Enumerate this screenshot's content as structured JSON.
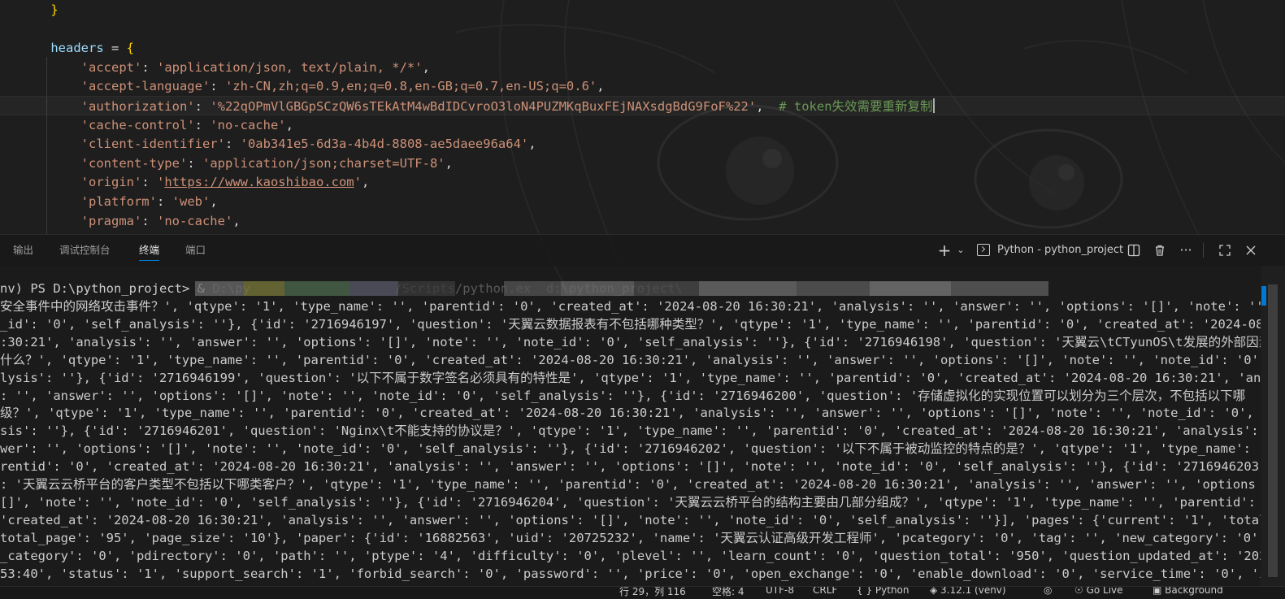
{
  "editor": {
    "lines": [
      {
        "parts": [
          {
            "t": "    ",
            "c": ""
          },
          {
            "t": "}",
            "c": "tk-brace"
          }
        ]
      },
      {
        "parts": []
      },
      {
        "parts": [
          {
            "t": "    ",
            "c": ""
          },
          {
            "t": "headers",
            "c": "tk-var"
          },
          {
            "t": " = ",
            "c": "tk-op"
          },
          {
            "t": "{",
            "c": "tk-brace"
          }
        ]
      },
      {
        "parts": [
          {
            "t": "        ",
            "c": ""
          },
          {
            "t": "'accept'",
            "c": "tk-str"
          },
          {
            "t": ": ",
            "c": "tk-op"
          },
          {
            "t": "'application/json, text/plain, */*'",
            "c": "tk-str"
          },
          {
            "t": ",",
            "c": "tk-op"
          }
        ]
      },
      {
        "parts": [
          {
            "t": "        ",
            "c": ""
          },
          {
            "t": "'accept-language'",
            "c": "tk-str"
          },
          {
            "t": ": ",
            "c": "tk-op"
          },
          {
            "t": "'zh-CN,zh;q=0.9,en;q=0.8,en-GB;q=0.7,en-US;q=0.6'",
            "c": "tk-str"
          },
          {
            "t": ",",
            "c": "tk-op"
          }
        ]
      },
      {
        "parts": [
          {
            "t": "        ",
            "c": ""
          },
          {
            "t": "'authorization'",
            "c": "tk-str"
          },
          {
            "t": ": ",
            "c": "tk-op"
          },
          {
            "t": "'%22qOPmVlGBGpSCzQW6sTEkAtM4wBdIDCvroO3loN4PUZMKqBuxFEjNAXsdgBdG9FoF%22'",
            "c": "tk-str"
          },
          {
            "t": ",  ",
            "c": "tk-op"
          },
          {
            "t": "# token失效需要重新复制",
            "c": "tk-comment"
          }
        ],
        "current": true
      },
      {
        "parts": [
          {
            "t": "        ",
            "c": ""
          },
          {
            "t": "'cache-control'",
            "c": "tk-str"
          },
          {
            "t": ": ",
            "c": "tk-op"
          },
          {
            "t": "'no-cache'",
            "c": "tk-str"
          },
          {
            "t": ",",
            "c": "tk-op"
          }
        ]
      },
      {
        "parts": [
          {
            "t": "        ",
            "c": ""
          },
          {
            "t": "'client-identifier'",
            "c": "tk-str"
          },
          {
            "t": ": ",
            "c": "tk-op"
          },
          {
            "t": "'0ab341e5-6d3a-4b4d-8808-ae5daee96a64'",
            "c": "tk-str"
          },
          {
            "t": ",",
            "c": "tk-op"
          }
        ]
      },
      {
        "parts": [
          {
            "t": "        ",
            "c": ""
          },
          {
            "t": "'content-type'",
            "c": "tk-str"
          },
          {
            "t": ": ",
            "c": "tk-op"
          },
          {
            "t": "'application/json;charset=UTF-8'",
            "c": "tk-str"
          },
          {
            "t": ",",
            "c": "tk-op"
          }
        ]
      },
      {
        "parts": [
          {
            "t": "        ",
            "c": ""
          },
          {
            "t": "'origin'",
            "c": "tk-str"
          },
          {
            "t": ": ",
            "c": "tk-op"
          },
          {
            "t": "'",
            "c": "tk-str"
          },
          {
            "t": "https://www.kaoshibao.com",
            "c": "tk-url"
          },
          {
            "t": "'",
            "c": "tk-str"
          },
          {
            "t": ",",
            "c": "tk-op"
          }
        ]
      },
      {
        "parts": [
          {
            "t": "        ",
            "c": ""
          },
          {
            "t": "'platform'",
            "c": "tk-str"
          },
          {
            "t": ": ",
            "c": "tk-op"
          },
          {
            "t": "'web'",
            "c": "tk-str"
          },
          {
            "t": ",",
            "c": "tk-op"
          }
        ]
      },
      {
        "parts": [
          {
            "t": "        ",
            "c": ""
          },
          {
            "t": "'pragma'",
            "c": "tk-str"
          },
          {
            "t": ": ",
            "c": "tk-op"
          },
          {
            "t": "'no-cache'",
            "c": "tk-str"
          },
          {
            "t": ",",
            "c": "tk-op"
          }
        ]
      }
    ]
  },
  "panel": {
    "tabs": [
      {
        "label": "输出",
        "active": false
      },
      {
        "label": "调试控制台",
        "active": false
      },
      {
        "label": "终端",
        "active": true
      },
      {
        "label": "端口",
        "active": false
      }
    ],
    "new_terminal_icon": "plus-icon",
    "dropdown_icon": "chevron-down-icon",
    "terminal_name": "Python - python_project",
    "split_icon": "split-editor-icon",
    "trash_icon": "trash-icon",
    "more_icon": "ellipsis-icon",
    "maximize_icon": "maximize-icon",
    "close_icon": "close-icon"
  },
  "terminal": {
    "prompt": "nv) PS D:\\python_project> & ",
    "prompt_rest": "D:\\py                   /Scripts/python.ex  d:\\python_project\\               ",
    "lines": [
      "安全事件中的网络攻击事件？', 'qtype': '1', 'type_name': '', 'parentid': '0', 'created_at': '2024-08-20 16:30:21', 'analysis': '', 'answer': '', 'options': '[]', 'note': '', '",
      "_id': '0', 'self_analysis': ''}, {'id': '2716946197', 'question': '天翼云数据报表有不包括哪种类型？', 'qtype': '1', 'type_name': '', 'parentid': '0', 'created_at': '2024-08-2",
      ":30:21', 'analysis': '', 'answer': '', 'options': '[]', 'note': '', 'note_id': '0', 'self_analysis': ''}, {'id': '2716946198', 'question': '天翼云\\tCTyunOS\\t发展的外部因素不",
      "什么？', 'qtype': '1', 'type_name': '', 'parentid': '0', 'created_at': '2024-08-20 16:30:21', 'analysis': '', 'answer': '', 'options': '[]', 'note': '', 'note_id': '0', 'self",
      "lysis': ''}, {'id': '2716946199', 'question': '以下不属于数字签名必须具有的特性是', 'qtype': '1', 'type_name': '', 'parentid': '0', 'created_at': '2024-08-20 16:30:21', 'anal",
      ": '', 'answer': '', 'options': '[]', 'note': '', 'note_id': '0', 'self_analysis': ''}, {'id': '2716946200', 'question': '存储虚拟化的实现位置可以划分为三个层次，不包括以下哪",
      "级？', 'qtype': '1', 'type_name': '', 'parentid': '0', 'created_at': '2024-08-20 16:30:21', 'analysis': '', 'answer': '', 'options': '[]', 'note': '', 'note_id': '0', 'self_a",
      "sis': ''}, {'id': '2716946201', 'question': 'Nginx\\t不能支持的协议是？', 'qtype': '1', 'type_name': '', 'parentid': '0', 'created_at': '2024-08-20 16:30:21', 'analysis': '',",
      "wer': '', 'options': '[]', 'note': '', 'note_id': '0', 'self_analysis': ''}, {'id': '2716946202', 'question': '以下不属于被动监控的特点的是？', 'qtype': '1', 'type_name': '',",
      "rentid': '0', 'created_at': '2024-08-20 16:30:21', 'analysis': '', 'answer': '', 'options': '[]', 'note': '', 'note_id': '0', 'self_analysis': ''}, {'id': '2716946203', 'ques",
      ": '天翼云云桥平台的客户类型不包括以下哪类客户？', 'qtype': '1', 'type_name': '', 'parentid': '0', 'created_at': '2024-08-20 16:30:21', 'analysis': '', 'answer': '', 'options",
      "[]', 'note': '', 'note_id': '0', 'self_analysis': ''}, {'id': '2716946204', 'question': '天翼云云桥平台的结构主要由几部分组成？', 'qtype': '1', 'type_name': '', 'parentid': '",
      "'created_at': '2024-08-20 16:30:21', 'analysis': '', 'answer': '', 'options': '[]', 'note': '', 'note_id': '0', 'self_analysis': ''}], 'pages': {'current': '1', 'total': '950",
      "total_page': '95', 'page_size': '10'}, 'paper': {'id': '16882563', 'uid': '20725232', 'name': '天翼云认证高级开发工程师', 'pcategory': '0', 'tag': '', 'new_category': '0', 'f",
      "_category': '0', 'pdirectory': '0', 'path': '', 'ptype': '4', 'difficulty': '0', 'plevel': '', 'learn_count': '0', 'question_total': '950', 'question_updated_at': '2024-11-19",
      "53:40', 'status': '1', 'support_search': '1', 'forbid_search': '0', 'password': '', 'price': '0', 'open_exchange': '0', 'enable_download': '0', 'service_time': '0', 'intro':"
    ]
  },
  "statusbar": {
    "position": "行 29，列 116",
    "spaces": "空格: 4",
    "encoding": "UTF-8",
    "eol": "CRLF",
    "language": "Python",
    "interpreter": "3.12.1 (venv)",
    "go_live": "Go Live",
    "background": "Background"
  },
  "colors": {
    "accent": "#0078d4",
    "string": "#ce9178",
    "variable": "#9cdcfe",
    "comment": "#6a9955",
    "brace": "#ffd700"
  }
}
